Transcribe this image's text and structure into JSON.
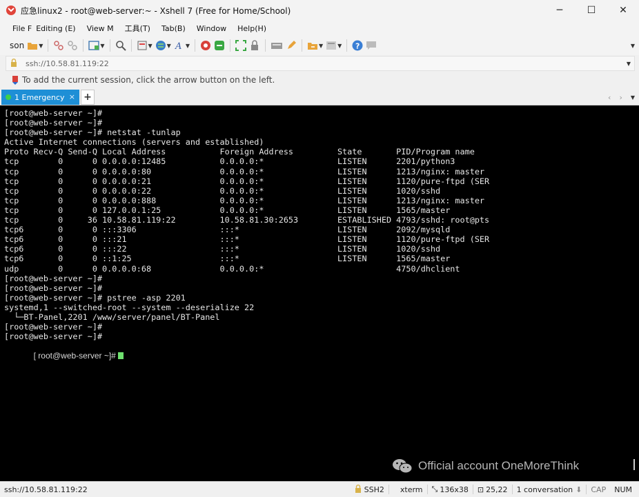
{
  "window": {
    "title": "应急linux2 - root@web-server:~ - Xshell 7 (Free for Home/School)",
    "minimize_glyph": "─",
    "maximize_glyph": "☐",
    "close_glyph": "✕"
  },
  "menu": {
    "items": [
      "File F",
      "Editing (E)",
      "View M",
      "工具(T)",
      "Tab(B)",
      "Window",
      "Help(H)"
    ]
  },
  "toolbar": {
    "session_label": "son"
  },
  "address": {
    "value": "ssh://10.58.81.119:22"
  },
  "hint": {
    "text": "To add the current session, click the arrow button on the left."
  },
  "tab": {
    "label": "1 Emergency",
    "close": "×",
    "add": "+",
    "prev": "‹",
    "next": "›"
  },
  "terminal": {
    "lines": [
      "[root@web-server ~]#",
      "[root@web-server ~]#",
      "[root@web-server ~]# netstat -tunlap",
      "Active Internet connections (servers and established)",
      "Proto Recv-Q Send-Q Local Address           Foreign Address         State       PID/Program name",
      "tcp        0      0 0.0.0.0:12485           0.0.0.0:*               LISTEN      2201/python3",
      "tcp        0      0 0.0.0.0:80              0.0.0.0:*               LISTEN      1213/nginx: master",
      "tcp        0      0 0.0.0.0:21              0.0.0.0:*               LISTEN      1120/pure-ftpd (SER",
      "tcp        0      0 0.0.0.0:22              0.0.0.0:*               LISTEN      1020/sshd",
      "tcp        0      0 0.0.0.0:888             0.0.0.0:*               LISTEN      1213/nginx: master",
      "tcp        0      0 127.0.0.1:25            0.0.0.0:*               LISTEN      1565/master",
      "tcp        0     36 10.58.81.119:22         10.58.81.30:2653        ESTABLISHED 4793/sshd: root@pts",
      "tcp6       0      0 :::3306                 :::*                    LISTEN      2092/mysqld",
      "tcp6       0      0 :::21                   :::*                    LISTEN      1120/pure-ftpd (SER",
      "tcp6       0      0 :::22                   :::*                    LISTEN      1020/sshd",
      "tcp6       0      0 ::1:25                  :::*                    LISTEN      1565/master",
      "udp        0      0 0.0.0.0:68              0.0.0.0:*                           4750/dhclient",
      "[root@web-server ~]#",
      "[root@web-server ~]#",
      "[root@web-server ~]# pstree -asp 2201",
      "systemd,1 --switched-root --system --deserialize 22",
      "  └─BT-Panel,2201 /www/server/panel/BT-Panel",
      "[root@web-server ~]#",
      "[root@web-server ~]#"
    ],
    "prompt": "[ root@web-server ~]# "
  },
  "watermark": {
    "text": "Official account OneMoreThink"
  },
  "status": {
    "address": "ssh://10.58.81.119:22",
    "protocol": "SSH2",
    "terminal_type": "xterm",
    "size": "136x38",
    "position": "25,22",
    "sessions": "1 conversation",
    "caps": "CAP",
    "num": "NUM"
  },
  "icons": {
    "app": "xshell-logo-icon",
    "lock": "lock-icon"
  },
  "colors": {
    "tab_active": "#1e8fd6",
    "terminal_bg": "#000000",
    "terminal_fg": "#e6e6e6",
    "cursor": "#6ee06e"
  }
}
